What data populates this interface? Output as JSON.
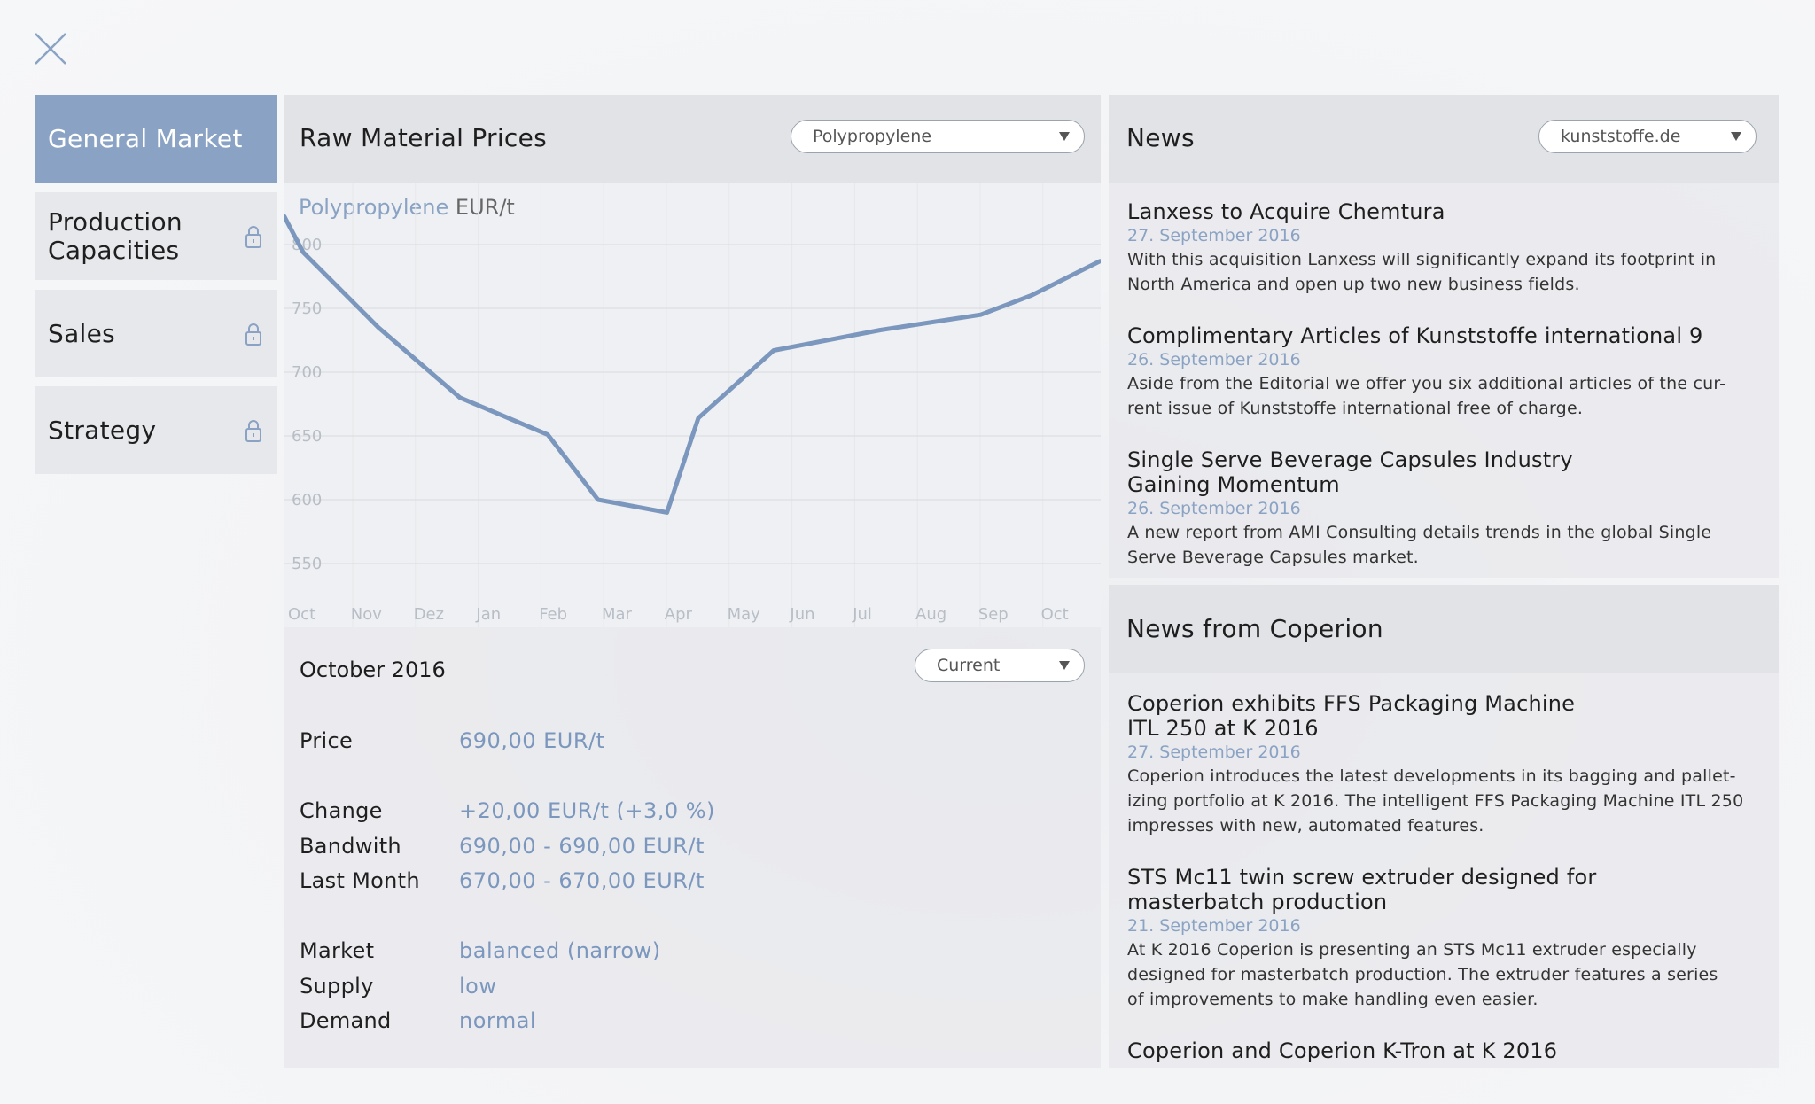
{
  "close_label": "",
  "sidebar": {
    "items": [
      {
        "label": "General Market",
        "locked": false,
        "active": true
      },
      {
        "label": "Production Capacities",
        "locked": true,
        "active": false
      },
      {
        "label": "Sales",
        "locked": true,
        "active": false
      },
      {
        "label": "Strategy",
        "locked": true,
        "active": false
      }
    ]
  },
  "raw_material": {
    "title": "Raw Material Prices",
    "dropdown_value": "Polypropylene",
    "chart_label_material": "Polypropylene",
    "chart_label_unit": "EUR/t"
  },
  "chart_data": {
    "type": "line",
    "title": "Polypropylene EUR/t",
    "xlabel": "",
    "ylabel": "EUR/t",
    "categories": [
      "Oct",
      "Nov",
      "Dez",
      "Jan",
      "Feb",
      "Mar",
      "Apr",
      "May",
      "Jun",
      "Jul",
      "Aug",
      "Sep",
      "Oct"
    ],
    "y_ticks": [
      800,
      750,
      700,
      650,
      600,
      550
    ],
    "ylim": [
      550,
      800
    ],
    "grid": true,
    "color": "#7b97bd",
    "series": [
      {
        "points": [
          {
            "x": -0.3,
            "y": 822
          },
          {
            "x": 0.0,
            "y": 794
          },
          {
            "x": 1.2,
            "y": 735
          },
          {
            "x": 2.5,
            "y": 680
          },
          {
            "x": 3.9,
            "y": 651
          },
          {
            "x": 4.7,
            "y": 600
          },
          {
            "x": 5.8,
            "y": 590
          },
          {
            "x": 6.3,
            "y": 664
          },
          {
            "x": 7.5,
            "y": 717
          },
          {
            "x": 9.2,
            "y": 733
          },
          {
            "x": 10.8,
            "y": 745
          },
          {
            "x": 11.6,
            "y": 760
          },
          {
            "x": 12.7,
            "y": 787
          }
        ]
      }
    ]
  },
  "details": {
    "period": "October 2016",
    "dropdown_value": "Current",
    "rows_a": [
      {
        "label": "Price",
        "value": "690,00 EUR/t"
      }
    ],
    "rows_b": [
      {
        "label": "Change",
        "value": "+20,00 EUR/t (+3,0 %)"
      },
      {
        "label": "Bandwith",
        "value": "690,00 - 690,00 EUR/t"
      },
      {
        "label": "Last Month",
        "value": "670,00 - 670,00 EUR/t"
      }
    ],
    "rows_c": [
      {
        "label": "Market",
        "value": "balanced (narrow)"
      },
      {
        "label": "Supply",
        "value": "low"
      },
      {
        "label": "Demand",
        "value": "normal"
      }
    ]
  },
  "news": {
    "title": "News",
    "dropdown_value": "kunststoffe.de",
    "items": [
      {
        "title_lines": [
          "Lanxess to Acquire Chemtura"
        ],
        "date": "27. September 2016",
        "body_lines": [
          "With this acquisition Lanxess will significantly expand its footprint in",
          "North America and open up two new business fields."
        ]
      },
      {
        "title_lines": [
          "Complimentary Articles of Kunststoffe international 9"
        ],
        "date": "26. September 2016",
        "body_lines": [
          "Aside from the Editorial we offer you six additional articles of the cur-",
          "rent issue of Kunststoffe international free of charge."
        ]
      },
      {
        "title_lines": [
          "Single Serve Beverage Capsules Industry",
          "Gaining Momentum"
        ],
        "date": "26. September 2016",
        "body_lines": [
          "A new report from AMI Consulting details trends in the global Single",
          "Serve Beverage Capsules market."
        ]
      }
    ]
  },
  "coperion": {
    "title": "News from Coperion",
    "items": [
      {
        "title_lines": [
          "Coperion exhibits FFS Packaging Machine",
          "ITL 250 at K 2016"
        ],
        "date": "27. September 2016",
        "body_lines": [
          "Coperion introduces the latest developments in its bagging and pallet-",
          "izing portfolio at K 2016. The intelligent FFS Packaging Machine ITL 250",
          "impresses with new, automated features."
        ]
      },
      {
        "title_lines": [
          "STS Mc11 twin screw extruder designed for",
          "masterbatch production"
        ],
        "date": "21. September 2016",
        "body_lines": [
          "At K 2016 Coperion is presenting an STS Mc11 extruder especially",
          "designed for masterbatch production. The extruder features a series",
          "of improvements to make handling even easier."
        ]
      },
      {
        "title_lines": [
          "Coperion and Coperion K-Tron at K 2016"
        ],
        "date": "",
        "body_lines": []
      }
    ]
  }
}
